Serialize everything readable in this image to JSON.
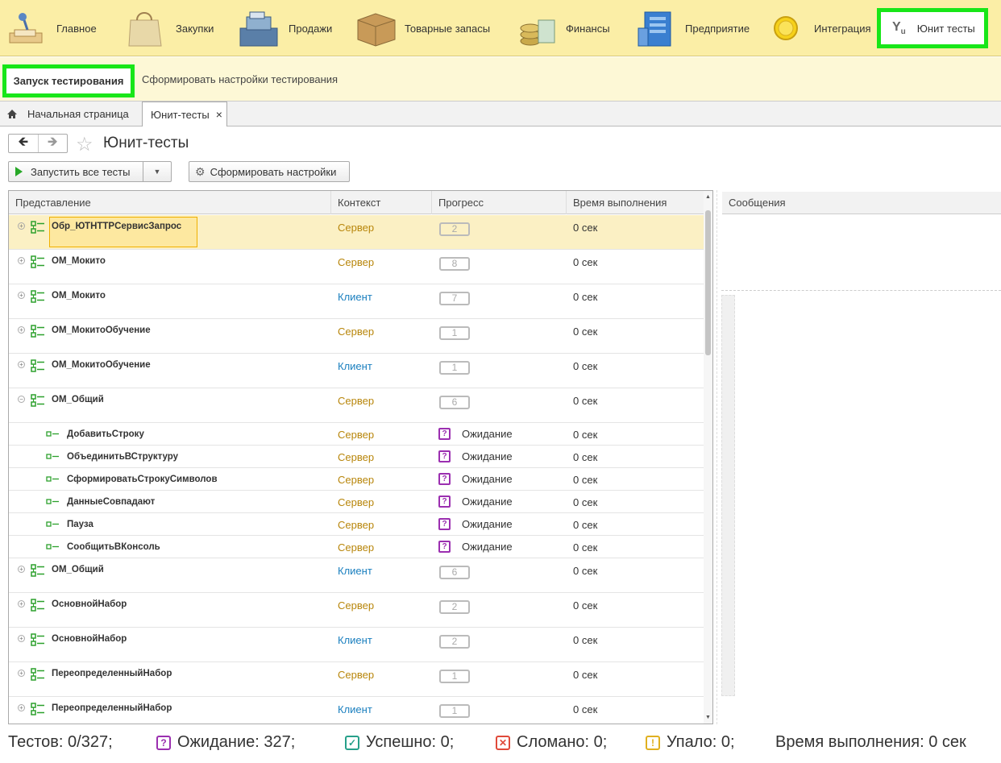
{
  "sections": [
    {
      "label": "Главное",
      "icon": "desk-icon"
    },
    {
      "label": "Закупки",
      "icon": "shopping-bag-icon"
    },
    {
      "label": "Продажи",
      "icon": "cash-register-icon"
    },
    {
      "label": "Товарные запасы",
      "icon": "box-icon"
    },
    {
      "label": "Финансы",
      "icon": "coins-icon"
    },
    {
      "label": "Предприятие",
      "icon": "building-icon"
    },
    {
      "label": "Интеграция",
      "icon": "coin-icon"
    },
    {
      "label": "Юнит тесты",
      "icon": "yu-icon"
    }
  ],
  "subsections": {
    "run": "Запуск тестирования",
    "make": "Сформировать настройки тестирования"
  },
  "tabs": {
    "home": "Начальная страница",
    "current": "Юнит-тесты",
    "close": "×"
  },
  "page": {
    "title": "Юнит-тесты"
  },
  "toolbar": {
    "run_all": "Запустить все тесты",
    "make_settings": "Сформировать настройки"
  },
  "grid": {
    "headers": {
      "name": "Представление",
      "ctx": "Контекст",
      "progress": "Прогресс",
      "time": "Время выполнения"
    },
    "rows": [
      {
        "name": "Обр_ЮТHTTPСервисЗапрос",
        "ctx": "Сервер",
        "count": "2",
        "time": "0 сек"
      },
      {
        "name": "ОМ_Мокито",
        "ctx": "Сервер",
        "count": "8",
        "time": "0 сек"
      },
      {
        "name": "ОМ_Мокито",
        "ctx": "Клиент",
        "count": "7",
        "time": "0 сек"
      },
      {
        "name": "ОМ_МокитоОбучение",
        "ctx": "Сервер",
        "count": "1",
        "time": "0 сек"
      },
      {
        "name": "ОМ_МокитоОбучение",
        "ctx": "Клиент",
        "count": "1",
        "time": "0 сек"
      },
      {
        "name": "ОМ_Общий",
        "ctx": "Сервер",
        "count": "6",
        "time": "0 сек"
      },
      {
        "name": "ДобавитьСтроку",
        "ctx": "Сервер",
        "status": "Ожидание",
        "time": "0 сек"
      },
      {
        "name": "ОбъединитьВСтруктуру",
        "ctx": "Сервер",
        "status": "Ожидание",
        "time": "0 сек"
      },
      {
        "name": "СформироватьСтрокуСимволов",
        "ctx": "Сервер",
        "status": "Ожидание",
        "time": "0 сек"
      },
      {
        "name": "ДанныеСовпадают",
        "ctx": "Сервер",
        "status": "Ожидание",
        "time": "0 сек"
      },
      {
        "name": "Пауза",
        "ctx": "Сервер",
        "status": "Ожидание",
        "time": "0 сек"
      },
      {
        "name": "СообщитьВКонсоль",
        "ctx": "Сервер",
        "status": "Ожидание",
        "time": "0 сек"
      },
      {
        "name": "ОМ_Общий",
        "ctx": "Клиент",
        "count": "6",
        "time": "0 сек"
      },
      {
        "name": "ОсновнойНабор",
        "ctx": "Сервер",
        "count": "2",
        "time": "0 сек"
      },
      {
        "name": "ОсновнойНабор",
        "ctx": "Клиент",
        "count": "2",
        "time": "0 сек"
      },
      {
        "name": "ПереопределенныйНабор",
        "ctx": "Сервер",
        "count": "1",
        "time": "0 сек"
      },
      {
        "name": "ПереопределенныйНабор",
        "ctx": "Клиент",
        "count": "1",
        "time": "0 сек"
      }
    ]
  },
  "messages": {
    "header": "Сообщения"
  },
  "status": {
    "tests": "Тестов: 0/327;",
    "waiting": "Ожидание: 327;",
    "success": "Успешно: 0;",
    "broken": "Сломано: 0;",
    "failed": "Упало: 0;",
    "time": "Время выполнения: 0 сек"
  },
  "colors": {
    "accent_highlight": "#18e618",
    "server": "#b8860b",
    "client": "#1a7fbf",
    "waiting": "#9b2fb0",
    "success": "#27a08a",
    "broken": "#e04a3a",
    "failed": "#e0b020"
  }
}
